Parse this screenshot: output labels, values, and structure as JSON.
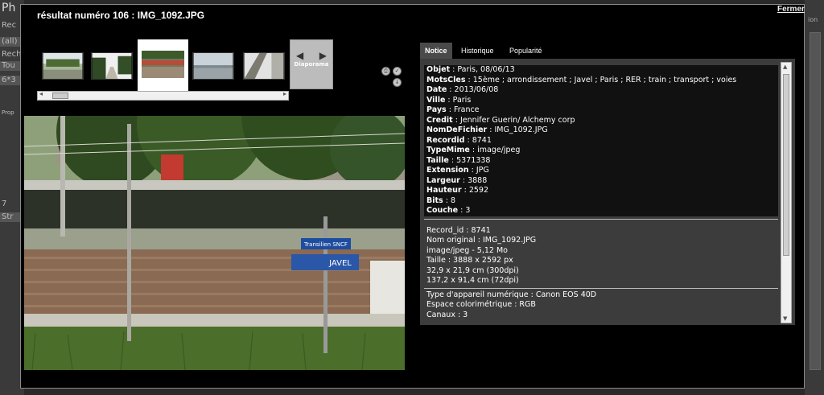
{
  "background": {
    "app_title": "Ph",
    "left_fragments": [
      "Rec",
      "(all)",
      "Rech",
      "Tou",
      "6*3",
      "Prop",
      "7",
      "Str"
    ],
    "right_fragment": "ion"
  },
  "header": {
    "title": "résultat numéro 106 : IMG_1092.JPG",
    "close_label": "Fermer"
  },
  "thumbnails": [
    {
      "name": "thumb-1"
    },
    {
      "name": "thumb-2"
    },
    {
      "name": "thumb-3-selected"
    },
    {
      "name": "thumb-4"
    },
    {
      "name": "thumb-5"
    }
  ],
  "diaporama_label": "Diaporama",
  "tabs": [
    {
      "label": "Notice",
      "active": true
    },
    {
      "label": "Historique",
      "active": false
    },
    {
      "label": "Popularité",
      "active": false
    }
  ],
  "metadata": [
    {
      "key": "Objet",
      "value": "Paris, 08/06/13"
    },
    {
      "key": "MotsCles",
      "value": "15ème ; arrondissement ; Javel ; Paris ; RER ; train ; transport ; voies"
    },
    {
      "key": "Date",
      "value": "2013/06/08"
    },
    {
      "key": "Ville",
      "value": "Paris"
    },
    {
      "key": "Pays",
      "value": "France"
    },
    {
      "key": "Credit",
      "value": "Jennifer Guerin/ Alchemy corp"
    },
    {
      "key": "NomDeFichier",
      "value": "IMG_1092.JPG"
    },
    {
      "key": "Recordid",
      "value": "8741"
    },
    {
      "key": "TypeMime",
      "value": "image/jpeg"
    },
    {
      "key": "Taille",
      "value": "5371338"
    },
    {
      "key": "Extension",
      "value": "JPG"
    },
    {
      "key": "Largeur",
      "value": "3888"
    },
    {
      "key": "Hauteur",
      "value": "2592"
    },
    {
      "key": "Bits",
      "value": "8"
    },
    {
      "key": "Couche",
      "value": "3"
    }
  ],
  "technical_info": [
    "Record_id : 8741",
    "Nom original : IMG_1092.JPG",
    "image/jpeg - 5,12 Mo",
    "Taille : 3888 x 2592 px",
    "32,9 x 21,9 cm (300dpi)",
    "137,2 x 91,4 cm (72dpi)"
  ],
  "exif_info": [
    "Type d'appareil numérique : Canon EOS 40D",
    "Espace colorimétrique : RGB",
    "Canaux : 3"
  ],
  "photo_signs": {
    "sign_top": "Transilien SNCF",
    "sign_bottom": "JAVEL"
  },
  "colors": {
    "modal_bg": "#000000",
    "panel_bg": "#3c3c3c",
    "row_dark": "#111111",
    "tab_active": "#4a4a4a"
  }
}
